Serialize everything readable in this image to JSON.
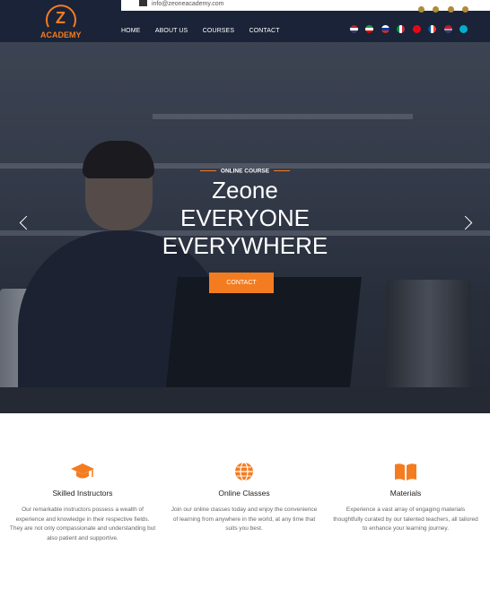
{
  "brand": {
    "logo_mark": "Z",
    "logo_text": "ACADEMY",
    "brand_color": "#f47c20"
  },
  "topbar": {
    "email": "info@zeoneacademy.com",
    "mail_icon": "envelope-icon",
    "social_icons": [
      "whatsapp-icon",
      "instagram-icon",
      "telegram-icon",
      "linkedin-icon"
    ]
  },
  "nav": {
    "items": [
      "HOME",
      "ABOUT US",
      "COURSES",
      "CONTACT"
    ]
  },
  "languages": [
    "en",
    "fa",
    "ru",
    "it",
    "tr",
    "fr",
    "us",
    "kz"
  ],
  "hero": {
    "kicker": "ONLINE COURSE",
    "title_line1": "Zeone",
    "title_line2": "EVERYONE",
    "title_line3": "EVERYWHERE",
    "button": "CONTACT",
    "prev_icon": "chevron-left-icon",
    "next_icon": "chevron-right-icon"
  },
  "features": [
    {
      "icon": "graduation-cap-icon",
      "title": "Skilled Instructors",
      "text": "Our remarkable instructors possess a wealth of experience and knowledge in their respective fields. They are not only compassionate and understanding but also patient and supportive."
    },
    {
      "icon": "globe-icon",
      "title": "Online Classes",
      "text": "Join our online classes today and enjoy the convenience of learning from anywhere in the world, at any time that suits you best."
    },
    {
      "icon": "book-icon",
      "title": "Materials",
      "text": "Experience a vast array of engaging materials thoughtfully curated by our talented teachers, all tailored to enhance your learning journey."
    }
  ]
}
